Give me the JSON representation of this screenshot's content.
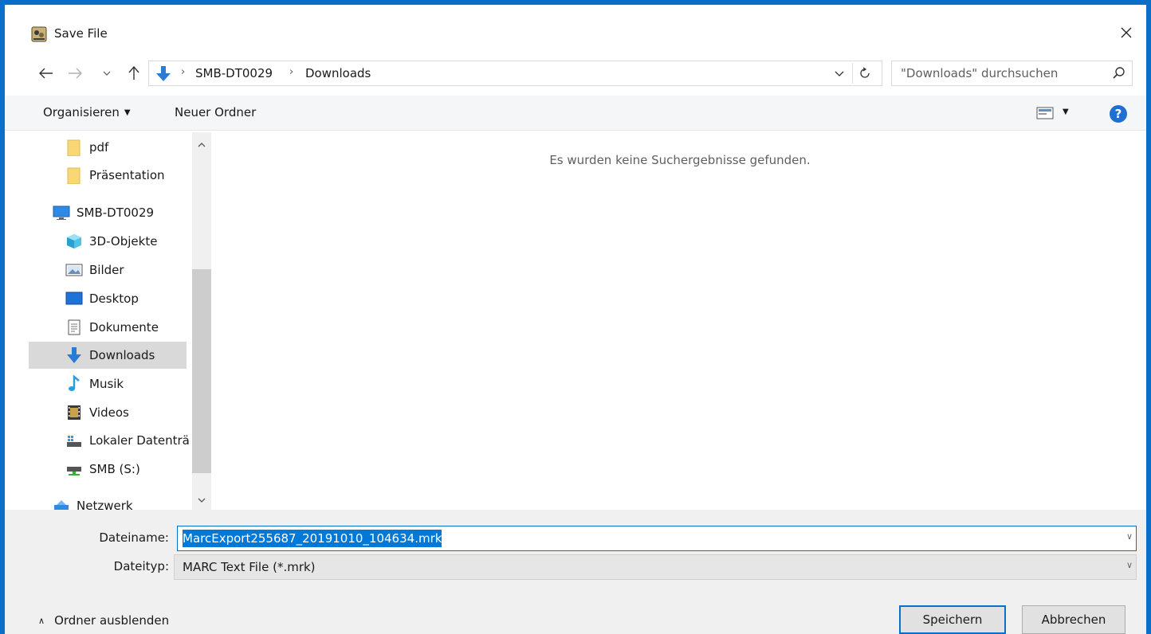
{
  "window": {
    "title": "Save File"
  },
  "address": {
    "crumbs": [
      "SMB-DT0029",
      "Downloads"
    ],
    "search_placeholder": "\"Downloads\" durchsuchen"
  },
  "toolbar": {
    "organize": "Organisieren",
    "new_folder": "Neuer Ordner"
  },
  "nav": {
    "items": [
      {
        "label": "pdf",
        "icon": "folder-icon"
      },
      {
        "label": "Präsentation",
        "icon": "folder-icon"
      },
      {
        "label": "SMB-DT0029",
        "icon": "computer-icon"
      },
      {
        "label": "3D-Objekte",
        "icon": "3d-objects-icon"
      },
      {
        "label": "Bilder",
        "icon": "pictures-icon"
      },
      {
        "label": "Desktop",
        "icon": "desktop-icon"
      },
      {
        "label": "Dokumente",
        "icon": "documents-icon"
      },
      {
        "label": "Downloads",
        "icon": "downloads-icon",
        "selected": true
      },
      {
        "label": "Musik",
        "icon": "music-icon"
      },
      {
        "label": "Videos",
        "icon": "videos-icon"
      },
      {
        "label": "Lokaler Datenträ",
        "icon": "local-disk-icon"
      },
      {
        "label": "SMB (S:)",
        "icon": "network-drive-icon"
      },
      {
        "label": "Netzwerk",
        "icon": "network-icon"
      }
    ]
  },
  "content": {
    "empty_message": "Es wurden keine Suchergebnisse gefunden."
  },
  "form": {
    "filename_label": "Dateiname:",
    "filename_value": "MarcExport255687_20191010_104634.mrk",
    "filetype_label": "Dateityp:",
    "filetype_value": "MARC Text File (*.mrk)"
  },
  "footer": {
    "hide_folders": "Ordner ausblenden",
    "save_label": "Speichern",
    "cancel_label": "Abbrechen"
  },
  "colors": {
    "accent": "#0a6fc8",
    "selection": "#0078d7",
    "folder": "#f8d775"
  }
}
